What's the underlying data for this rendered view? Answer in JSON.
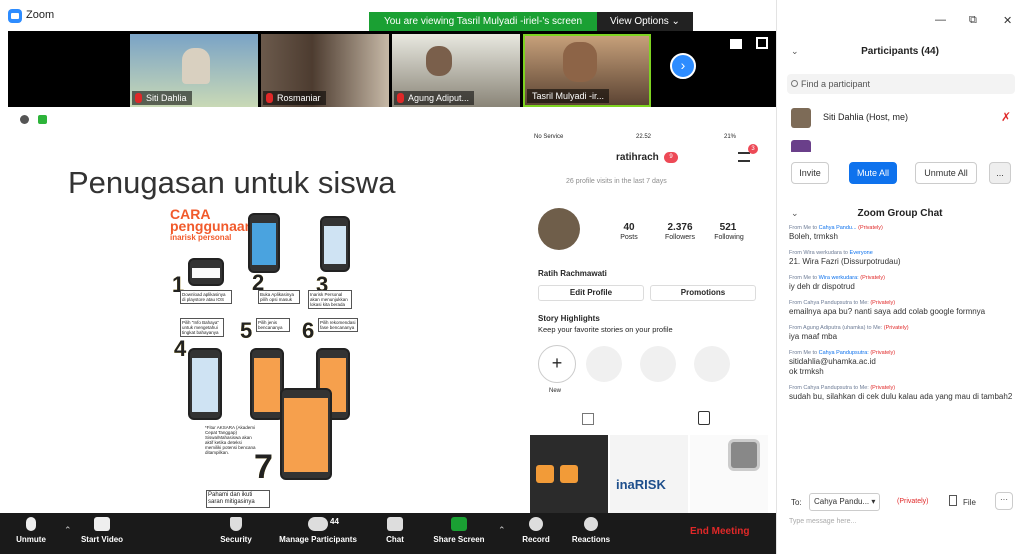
{
  "window": {
    "title": "Zoom",
    "controls": [
      "—",
      "⧉",
      "✕"
    ]
  },
  "banner": {
    "viewing": "You are viewing Tasril Mulyadi -iriel-'s screen",
    "view_options": "View Options ⌄"
  },
  "thumbnails": [
    {
      "name": "Siti Dahlia",
      "muted": true
    },
    {
      "name": "Rosmaniar",
      "muted": true
    },
    {
      "name": "Agung Adiput...",
      "muted": true
    },
    {
      "name": "Tasril Mulyadi -ir...",
      "muted": false
    }
  ],
  "slide": {
    "title": "Penugasan untuk siswa",
    "guide": {
      "heading1": "CARA",
      "heading2": "penggunaan",
      "heading3": "inarisk personal",
      "steps": [
        {
          "n": "1",
          "text": "Download aplikasinya di playstore atau IOS"
        },
        {
          "n": "2",
          "text": "Buka Aplikasinya pilih opsi masuk"
        },
        {
          "n": "3",
          "text": "Inarisk Personal akan menunjukkan lokasi kita berada"
        },
        {
          "n": "4",
          "text": "Pilih \"Info Bahaya\" untuk mengetahui tingkat bahayanya"
        },
        {
          "n": "5",
          "text": "Pilih jenis bencananya"
        },
        {
          "n": "6",
          "text": "Pilih rekomendasi fase bencananya"
        },
        {
          "n": "7",
          "text": "Pahami dan ikuti saran mitigasinya"
        }
      ],
      "footnote": "*Fitur AKSARA (Akademi Cepat Tanggap) Siswa/Mahasiswa akan aktif ketika deteksi memiliki potensi bencana ditampilkan."
    }
  },
  "instagram": {
    "status_left": "No Service",
    "time": "22.52",
    "battery": "21%",
    "username": "ratihrach",
    "notif_count": "9",
    "menu_badge": "3",
    "visits": "26 profile visits in the last 7 days",
    "stats": [
      {
        "value": "40",
        "label": "Posts"
      },
      {
        "value": "2.376",
        "label": "Followers"
      },
      {
        "value": "521",
        "label": "Following"
      }
    ],
    "fullname": "Ratih Rachmawati",
    "edit_profile": "Edit Profile",
    "promotions": "Promotions",
    "highlights_title": "Story Highlights",
    "highlights_sub": "Keep your favorite stories on your profile",
    "new_label": "New",
    "inarisk_label": "inaRISK"
  },
  "toolbar": {
    "unmute": "Unmute",
    "start_video": "Start Video",
    "security": "Security",
    "manage_participants": "Manage Participants",
    "participant_count": "44",
    "chat": "Chat",
    "share_screen": "Share Screen",
    "record": "Record",
    "reactions": "Reactions",
    "end_meeting": "End Meeting"
  },
  "participants": {
    "title": "Participants (44)",
    "search_placeholder": "Find a participant",
    "host": "Siti Dahlia (Host, me)",
    "invite": "Invite",
    "mute_all": "Mute All",
    "unmute_all": "Unmute All",
    "more": "..."
  },
  "chat": {
    "title": "Zoom Group Chat",
    "messages": [
      {
        "meta_from": "From Me to",
        "meta_to": "Cahya Pandu...",
        "meta_priv": "(Privately)",
        "text": "Boleh, trmksh"
      },
      {
        "meta_from": "From Wira werkudara to",
        "meta_to": "Everyone",
        "meta_priv": "",
        "text": "21. Wira Fazri (Dissurpotrudau)"
      },
      {
        "meta_from": "From Me to",
        "meta_to": "Wira werkudara:",
        "meta_priv": "(Privately)",
        "text": "iy deh dr dispotrud"
      },
      {
        "meta_from": "From Cahya Pandupsutra to Me:",
        "meta_to": "",
        "meta_priv": "(Privately)",
        "text": "emailnya apa bu? nanti saya add colab google formnya"
      },
      {
        "meta_from": "From Agung Adiputra (uhamka) to Me:",
        "meta_to": "",
        "meta_priv": "(Privately)",
        "text": "iya maaf mba"
      },
      {
        "meta_from": "From Me to",
        "meta_to": "Cahya Pandupsutra:",
        "meta_priv": "(Privately)",
        "text": "sitidahlia@uhamka.ac.id\nok trmksh"
      },
      {
        "meta_from": "From Cahya Pandupsutra to Me:",
        "meta_to": "",
        "meta_priv": "(Privately)",
        "text": "sudah bu, silahkan di cek dulu kalau ada yang mau di tambah2"
      }
    ],
    "to_label": "To:",
    "recipient": "Cahya Pandu...",
    "private_label": "(Privately)",
    "file_label": "File",
    "more": "···",
    "input_placeholder": "Type message here..."
  },
  "colors": {
    "accent": "#0e72ed",
    "green": "#1aa033",
    "end": "#e02828",
    "toolbar": "#1a1a1a",
    "orange": "#f15a2b"
  }
}
